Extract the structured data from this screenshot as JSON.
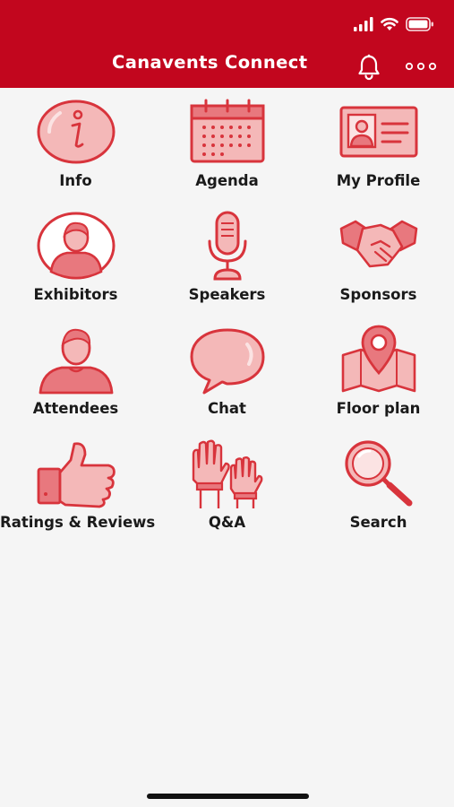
{
  "header": {
    "title": "Canavents Connect",
    "bell_icon": "bell-icon",
    "more_icon": "more-dots-icon",
    "status_icons": [
      "signal-icon",
      "wifi-icon",
      "battery-icon"
    ]
  },
  "colors": {
    "header_bg": "#c2061e",
    "icon_stroke": "#d8343c",
    "icon_fill": "#f4b8b8",
    "page_bg": "#f5f5f5"
  },
  "menu": {
    "items": [
      {
        "label": "Info",
        "icon": "info-icon"
      },
      {
        "label": "Agenda",
        "icon": "calendar-icon"
      },
      {
        "label": "My Profile",
        "icon": "profile-card-icon"
      },
      {
        "label": "Exhibitors",
        "icon": "exhibitor-person-icon"
      },
      {
        "label": "Speakers",
        "icon": "microphone-icon"
      },
      {
        "label": "Sponsors",
        "icon": "handshake-icon"
      },
      {
        "label": "Attendees",
        "icon": "attendee-person-icon"
      },
      {
        "label": "Chat",
        "icon": "chat-bubble-icon"
      },
      {
        "label": "Floor plan",
        "icon": "map-pin-icon"
      },
      {
        "label": "Ratings & Reviews",
        "icon": "thumbs-up-icon"
      },
      {
        "label": "Q&A",
        "icon": "raised-hands-icon"
      },
      {
        "label": "Search",
        "icon": "magnifier-icon"
      }
    ]
  }
}
